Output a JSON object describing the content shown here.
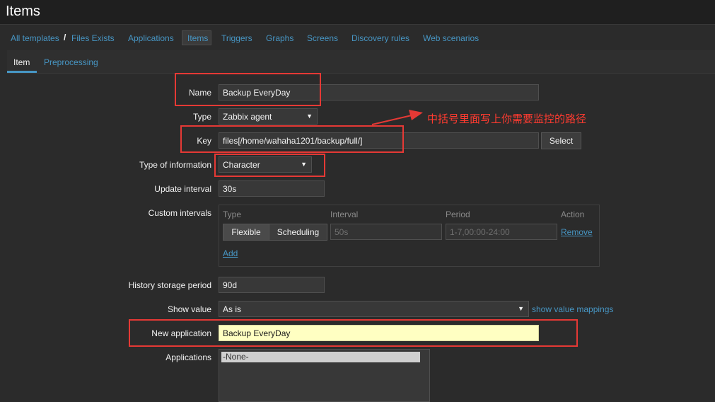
{
  "header": {
    "title": "Items"
  },
  "nav": {
    "all_templates": "All templates",
    "separator": "/",
    "template": "Files Exists",
    "applications": "Applications",
    "items": "Items",
    "triggers": "Triggers",
    "graphs": "Graphs",
    "screens": "Screens",
    "discovery_rules": "Discovery rules",
    "web_scenarios": "Web scenarios"
  },
  "tabs": {
    "item": "Item",
    "preprocessing": "Preprocessing"
  },
  "form": {
    "name_label": "Name",
    "name_value": "Backup EveryDay",
    "type_label": "Type",
    "type_value": "Zabbix agent",
    "key_label": "Key",
    "key_value": "files[/home/wahaha1201/backup/full/]",
    "key_select_button": "Select",
    "type_info_label": "Type of information",
    "type_info_value": "Character",
    "update_interval_label": "Update interval",
    "update_interval_value": "30s",
    "custom_intervals_label": "Custom intervals",
    "custom_intervals": {
      "col_type": "Type",
      "col_interval": "Interval",
      "col_period": "Period",
      "col_action": "Action",
      "flexible": "Flexible",
      "scheduling": "Scheduling",
      "interval_placeholder": "50s",
      "period_placeholder": "1-7,00:00-24:00",
      "remove": "Remove",
      "add": "Add"
    },
    "history_label": "History storage period",
    "history_value": "90d",
    "show_value_label": "Show value",
    "show_value_value": "As is",
    "show_value_mappings": "show value mappings",
    "new_application_label": "New application",
    "new_application_value": "Backup EveryDay",
    "applications_label": "Applications",
    "applications_option": "-None-"
  },
  "annotation": {
    "text": "中括号里面写上你需要监控的路径"
  },
  "colors": {
    "link": "#4796c4",
    "annotation": "#e53935",
    "highlight_input": "#ffffc2"
  }
}
